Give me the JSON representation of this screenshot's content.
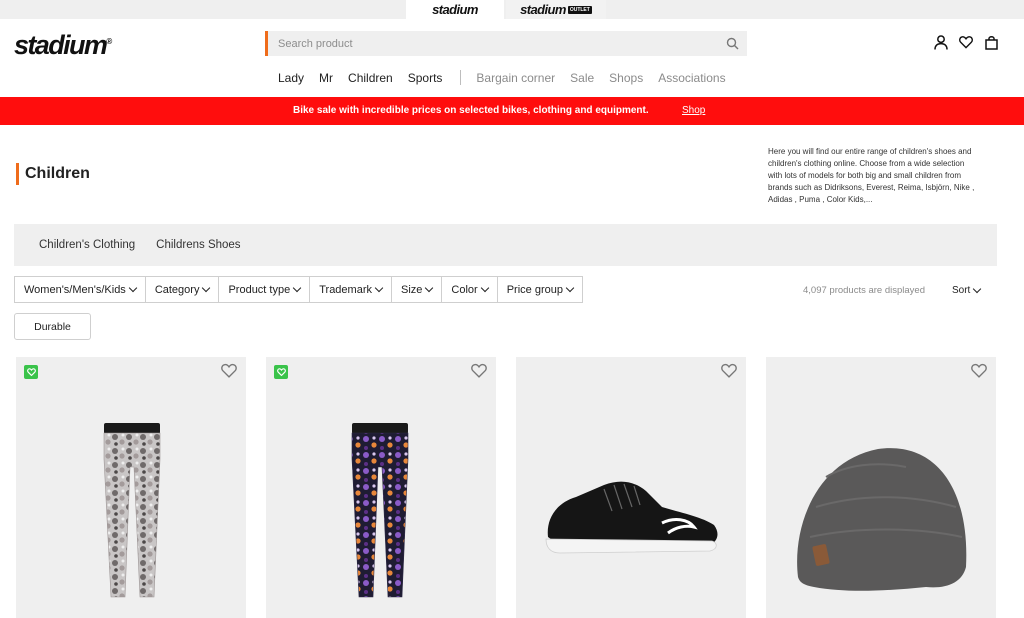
{
  "brandbar": {
    "stadium": "stadium",
    "outlet_name": "stadium",
    "outlet_badge": "OUTLET"
  },
  "header": {
    "logo": "stadium",
    "search_placeholder": "Search product"
  },
  "nav": {
    "primary": [
      "Lady",
      "Mr",
      "Children",
      "Sports"
    ],
    "secondary": [
      "Bargain corner",
      "Sale",
      "Shops",
      "Associations"
    ]
  },
  "promo": {
    "message": "Bike sale with incredible prices on selected bikes, clothing and equipment.",
    "link": "Shop"
  },
  "page": {
    "title": "Children",
    "intro": "Here you will find our entire range of children's shoes and children's clothing online. Choose from a wide selection with lots of models for both big and small children from brands such as Didriksons, Everest, Reima, Isbjörn, Nike , Adidas , Puma , Color Kids,..."
  },
  "subcategories": [
    "Children's Clothing",
    "Childrens Shoes"
  ],
  "filters": [
    "Women's/Men's/Kids",
    "Category",
    "Product type",
    "Trademark",
    "Size",
    "Color",
    "Price group"
  ],
  "results": {
    "count_text": "4,097 products are displayed",
    "sort_label": "Sort"
  },
  "tags": {
    "durable": "Durable"
  },
  "colors": {
    "accent": "#ef6c1b",
    "promo_red": "#ff0d0d",
    "eco_green": "#3ac34a",
    "panel_gray": "#efefef"
  },
  "products": [
    {
      "image": "grey-floral-leggings",
      "eco_badge": true
    },
    {
      "image": "purple-floral-leggings",
      "eco_badge": true
    },
    {
      "image": "black-puma-indoor-shoe",
      "eco_badge": false
    },
    {
      "image": "grey-beanie",
      "eco_badge": false
    }
  ]
}
